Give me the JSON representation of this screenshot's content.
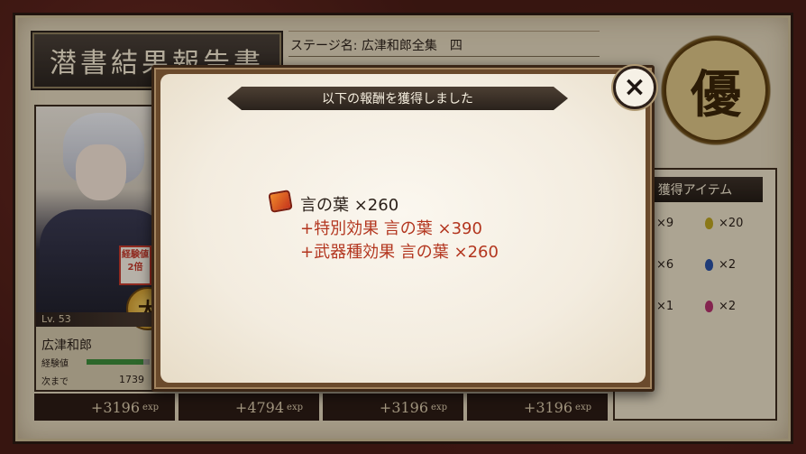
{
  "report": {
    "title": "潜書結果報告書",
    "stage_name": "ステージ名: 広津和郎全集　四",
    "grade": "優"
  },
  "items_panel": {
    "header": "獲得アイテム",
    "items": [
      {
        "count": "×9"
      },
      {
        "count": "×20",
        "icon": "yellow-gem-icon",
        "color": "#b8a020"
      },
      {
        "count": "×6"
      },
      {
        "count": "×2",
        "icon": "blue-gem-icon",
        "color": "#2a4fa0"
      },
      {
        "count": "×1"
      },
      {
        "count": "×2",
        "icon": "pink-gem-icon",
        "color": "#b0306a"
      }
    ]
  },
  "character": {
    "level": "Lv. 53",
    "name": "広津和郎",
    "exp_label": "経験値",
    "exp_progress": 0.9,
    "next_label": "次まで",
    "next_value": "1739",
    "bonus_tag": "経験値2倍",
    "great_badge": "大"
  },
  "cards_exp": [
    {
      "value": "+3196",
      "unit": "exp"
    },
    {
      "value": "+4794",
      "unit": "exp"
    },
    {
      "value": "+3196",
      "unit": "exp"
    },
    {
      "value": "+3196",
      "unit": "exp"
    }
  ],
  "modal": {
    "title": "以下の報酬を獲得しました",
    "close_label": "×",
    "reward_main": "言の葉 ×260",
    "bonuses": [
      "+特別効果 言の葉 ×390",
      "+武器種効果 言の葉 ×260"
    ]
  }
}
